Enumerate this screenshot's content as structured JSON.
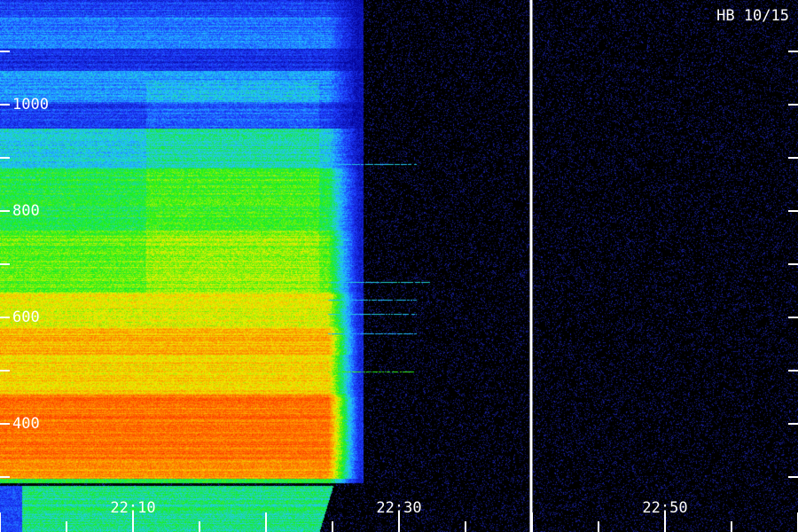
{
  "chart_data": {
    "type": "heatmap",
    "title": "HB 10/15",
    "xlabel": "",
    "ylabel": "",
    "x_ticks": [
      "22:10",
      "22:30",
      "22:50"
    ],
    "y_ticks": [
      400,
      600,
      800,
      1000
    ],
    "ylim": [
      260,
      1200
    ],
    "colormap": [
      "#05059a",
      "#1e3cff",
      "#22c8ff",
      "#18f018",
      "#f0f000",
      "#ff8000",
      "#ff1e00"
    ],
    "fade_time_label": "22:30",
    "marker_line": "22:40",
    "background_color": "#000000",
    "text_color": "#ffffff"
  }
}
